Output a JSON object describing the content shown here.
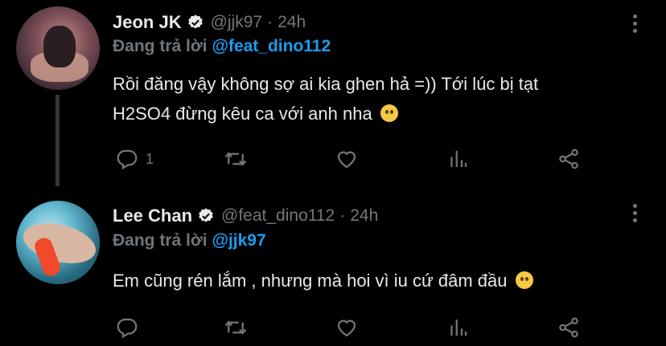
{
  "tweets": [
    {
      "name": "Jeon JK",
      "handle": "@jjk97",
      "separator": "·",
      "time": "24h",
      "reply_prefix": "Đang trả lời",
      "reply_mention": "@feat_dino112",
      "text_line1": "Rồi đăng vậy không sợ ai kia ghen hả =))  Tới lúc bị tạt",
      "text_line2": "H2SO4 đừng kêu ca với anh nha",
      "emoji": "rolling-eyes-emoji",
      "reply_count": "1"
    },
    {
      "name": "Lee Chan",
      "handle": "@feat_dino112",
      "separator": "·",
      "time": "24h",
      "reply_prefix": "Đang trả lời",
      "reply_mention": "@jjk97",
      "text_line1": "Em cũng rén lắm , nhưng mà hoi vì iu cứ đâm đầu",
      "emoji": "shushing-face-emoji",
      "reply_count": ""
    }
  ],
  "colors": {
    "background": "#000000",
    "text": "#e7e9ea",
    "muted": "#71767b",
    "accent": "#1d9bf0"
  }
}
